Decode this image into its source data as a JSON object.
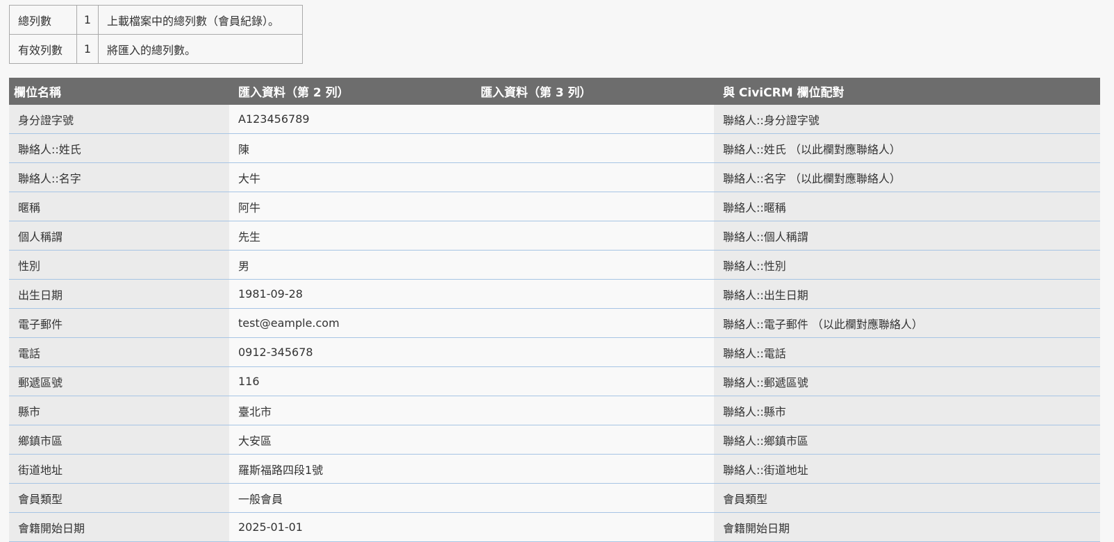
{
  "summary": {
    "rows": [
      {
        "label": "總列數",
        "count": "1",
        "desc": "上載檔案中的總列數（會員紀錄）。"
      },
      {
        "label": "有效列數",
        "count": "1",
        "desc": "將匯入的總列數。"
      }
    ]
  },
  "mapping": {
    "headers": {
      "field_name": "欄位名稱",
      "import_row2": "匯入資料（第 2 列）",
      "import_row3": "匯入資料（第 3 列）",
      "civicrm_match": "與 CiviCRM 欄位配對"
    },
    "rows": [
      {
        "field": "身分證字號",
        "row2": "A123456789",
        "row3": "",
        "match": "聯絡人::身分證字號"
      },
      {
        "field": "聯絡人::姓氏",
        "row2": "陳",
        "row3": "",
        "match": "聯絡人::姓氏 （以此欄對應聯絡人）"
      },
      {
        "field": "聯絡人::名字",
        "row2": "大牛",
        "row3": "",
        "match": "聯絡人::名字 （以此欄對應聯絡人）"
      },
      {
        "field": "暱稱",
        "row2": "阿牛",
        "row3": "",
        "match": "聯絡人::暱稱"
      },
      {
        "field": "個人稱謂",
        "row2": "先生",
        "row3": "",
        "match": "聯絡人::個人稱謂"
      },
      {
        "field": "性別",
        "row2": "男",
        "row3": "",
        "match": "聯絡人::性別"
      },
      {
        "field": "出生日期",
        "row2": "1981-09-28",
        "row3": "",
        "match": "聯絡人::出生日期"
      },
      {
        "field": "電子郵件",
        "row2": "test@eample.com",
        "row3": "",
        "match": "聯絡人::電子郵件 （以此欄對應聯絡人）"
      },
      {
        "field": "電話",
        "row2": "0912-345678",
        "row3": "",
        "match": "聯絡人::電話"
      },
      {
        "field": "郵遞區號",
        "row2": "116",
        "row3": "",
        "match": "聯絡人::郵遞區號"
      },
      {
        "field": "縣市",
        "row2": "臺北市",
        "row3": "",
        "match": "聯絡人::縣市"
      },
      {
        "field": "鄉鎮市區",
        "row2": "大安區",
        "row3": "",
        "match": "聯絡人::鄉鎮市區"
      },
      {
        "field": "街道地址",
        "row2": "羅斯福路四段1號",
        "row3": "",
        "match": "聯絡人::街道地址"
      },
      {
        "field": "會員類型",
        "row2": "一般會員",
        "row3": "",
        "match": "會員類型"
      },
      {
        "field": "會籍開始日期",
        "row2": "2025-01-01",
        "row3": "",
        "match": "會籍開始日期"
      }
    ]
  }
}
